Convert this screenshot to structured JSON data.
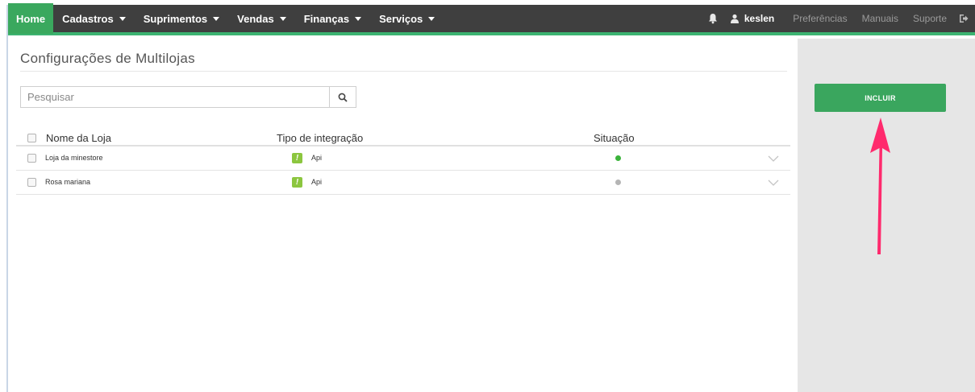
{
  "navbar": {
    "home": "Home",
    "menus": [
      {
        "label": "Cadastros"
      },
      {
        "label": "Suprimentos"
      },
      {
        "label": "Vendas"
      },
      {
        "label": "Finanças"
      },
      {
        "label": "Serviços"
      }
    ],
    "user": "keslen",
    "links": [
      "Preferências",
      "Manuais",
      "Suporte"
    ],
    "icons": [
      "bell-icon",
      "user-icon",
      "logout-icon"
    ]
  },
  "page": {
    "title": "Configurações de Multilojas"
  },
  "search": {
    "placeholder": "Pesquisar"
  },
  "table": {
    "columns": [
      "Nome da Loja",
      "Tipo de integração",
      "Situação"
    ],
    "rows": [
      {
        "name": "Loja da minestore",
        "type": "Api",
        "status": "active",
        "status_color": "#3bb33b"
      },
      {
        "name": "Rosa mariana",
        "type": "Api",
        "status": "inactive",
        "status_color": "#b5b5b5"
      }
    ]
  },
  "side": {
    "include_label": "INCLUIR"
  },
  "colors": {
    "navbar_bg": "#3f3f3f",
    "accent_green": "#3aa65e",
    "annotation_arrow": "#ff2a6d"
  }
}
